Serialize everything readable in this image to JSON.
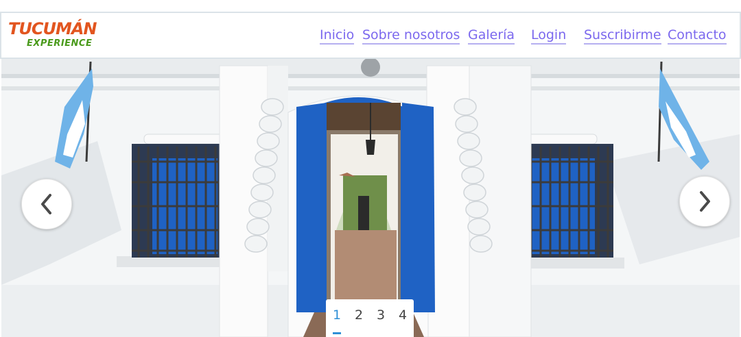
{
  "brand": {
    "logo_text": "TUCUMÁN",
    "logo_subtext": "EXPERIENCE"
  },
  "nav": {
    "links": [
      {
        "label": "Inicio"
      },
      {
        "label": "Sobre nosotros"
      },
      {
        "label": "Galería"
      },
      {
        "label": "Login"
      },
      {
        "label": "Suscribirme"
      },
      {
        "label": "Contacto"
      }
    ]
  },
  "carousel": {
    "prev_icon": "chevron-left-icon",
    "next_icon": "chevron-right-icon",
    "pages": [
      "1",
      "2",
      "3",
      "4"
    ],
    "active_page": 1
  },
  "colors": {
    "nav_link": "#7b68ee",
    "pager_active": "#2f8fd6",
    "door_blue": "#1f62c4",
    "flag_blue": "#6fb3e8"
  }
}
